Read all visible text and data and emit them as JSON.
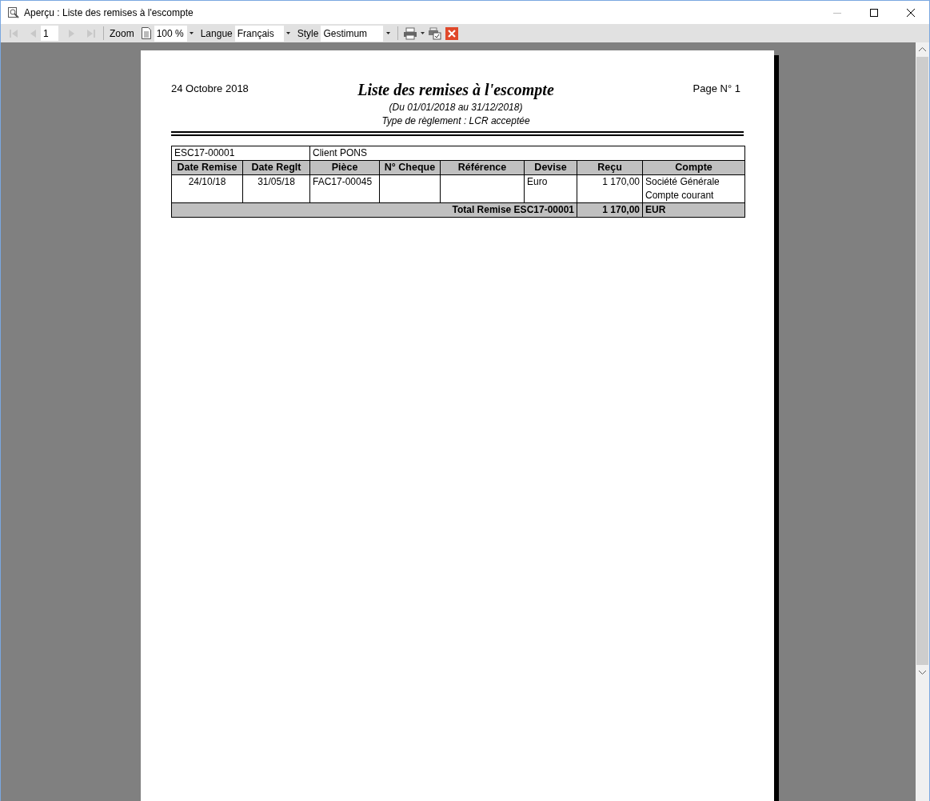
{
  "window": {
    "title": "Aperçu : Liste des remises à l'escompte"
  },
  "toolbar": {
    "nav": [
      {
        "kind": "first",
        "disabled": true
      },
      {
        "kind": "prev",
        "disabled": true
      },
      {
        "kind": "page",
        "value": "1"
      },
      {
        "kind": "next",
        "disabled": true
      },
      {
        "kind": "last",
        "disabled": true
      }
    ],
    "zoom_label": "Zoom",
    "zoom_value": "100 %",
    "language_label": "Langue",
    "language_value": "Français",
    "style_label": "Style",
    "style_value": "Gestimum"
  },
  "report": {
    "date": "24 Octobre 2018",
    "title": "Liste des remises à l'escompte",
    "page": "Page N° 1",
    "period": "(Du 01/01/2018 au 31/12/2018)",
    "payment_type": "Type de règlement : LCR acceptée",
    "group": {
      "code": "ESC17-00001",
      "client": "Client PONS"
    },
    "columns": [
      "Date Remise",
      "Date Reglt",
      "Pièce",
      "N° Cheque",
      "Référence",
      "Devise",
      "Reçu",
      "Compte"
    ],
    "rows": [
      [
        "24/10/18",
        "31/05/18",
        "FAC17-00045",
        "",
        "",
        "Euro",
        "1 170,00",
        "Société Générale\nCompte courant"
      ]
    ],
    "total": {
      "label": "Total Remise ESC17-00001",
      "amount": "1 170,00",
      "currency": "EUR"
    }
  }
}
